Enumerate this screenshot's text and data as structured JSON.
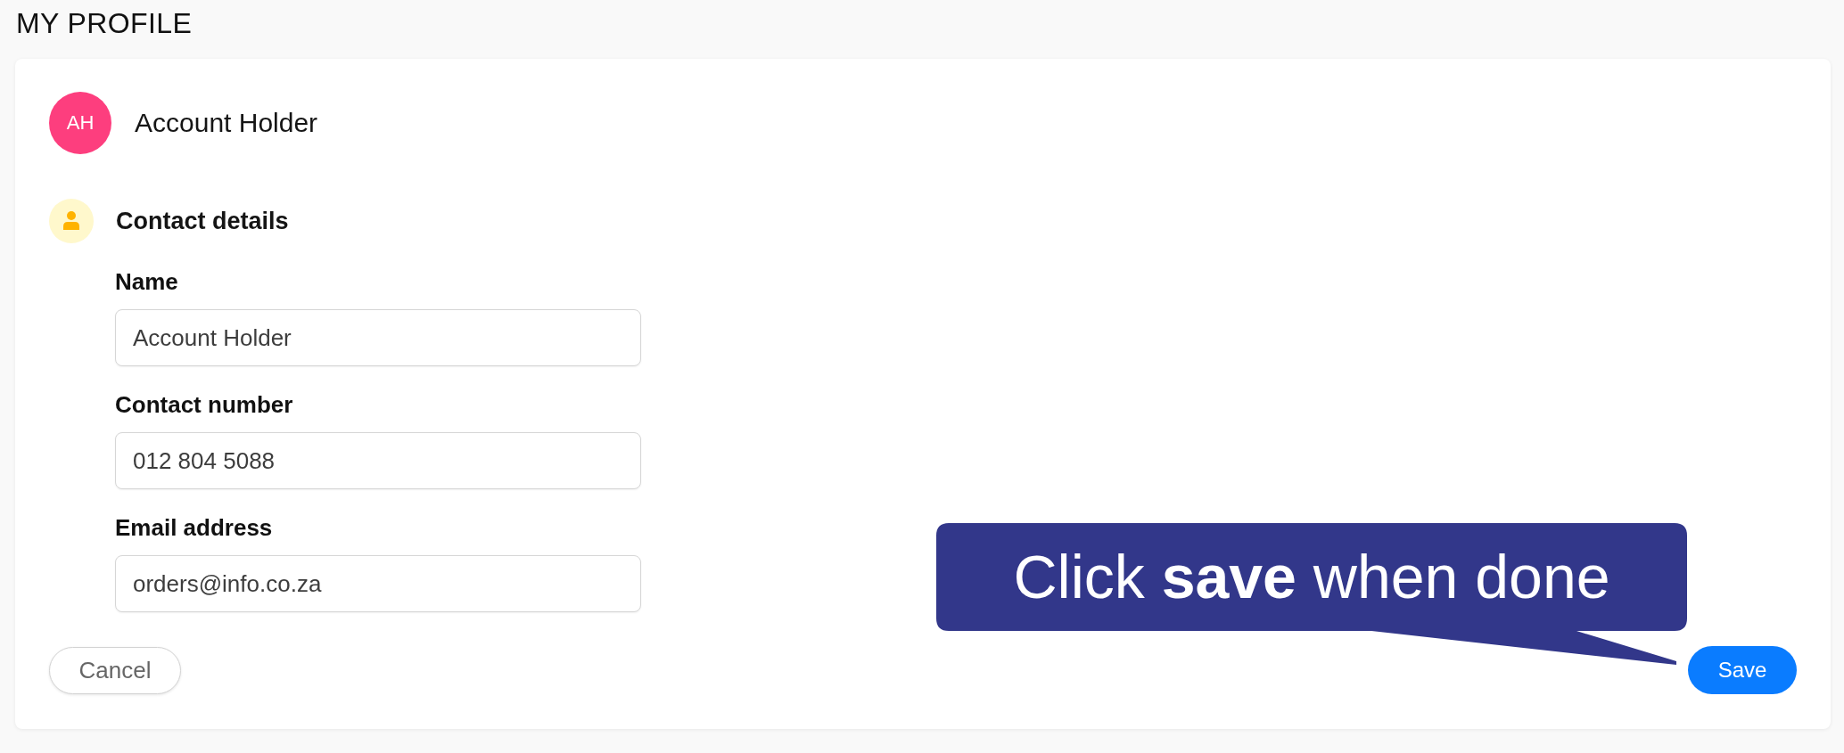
{
  "page": {
    "title": "MY PROFILE"
  },
  "profile": {
    "initials": "AH",
    "name": "Account Holder"
  },
  "section": {
    "title": "Contact details"
  },
  "fields": [
    {
      "label": "Name",
      "value": "Account Holder"
    },
    {
      "label": "Contact number",
      "value": "012 804 5088"
    },
    {
      "label": "Email address",
      "value": "orders@info.co.za"
    }
  ],
  "buttons": [
    {
      "label": "Cancel",
      "kind": "secondary"
    },
    {
      "label": "Save",
      "kind": "primary"
    }
  ],
  "callout": {
    "text": "Click **save** when done"
  }
}
